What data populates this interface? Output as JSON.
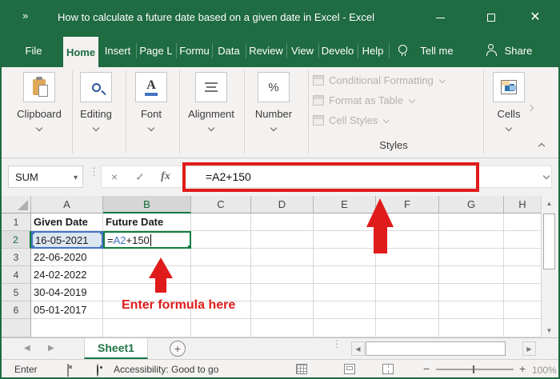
{
  "colors": {
    "title_green": "#1f6b42",
    "accent_green": "#217346",
    "selection_green": "#107c41",
    "reference_blue": "#4472c4",
    "reference_blue_bg": "#dce6f1",
    "annotation_red": "#e01b1b"
  },
  "titlebar": {
    "overflow_icon": "»",
    "title": "How to calculate a future date based on a given date in Excel  -  Excel"
  },
  "tabs": {
    "file": "File",
    "home": "Home",
    "insert": "Insert",
    "page_layout": "Page L",
    "formulas": "Formu",
    "data": "Data",
    "review": "Review",
    "view": "View",
    "developer": "Develo",
    "help": "Help",
    "tell_me": "Tell me",
    "share": "Share"
  },
  "ribbon": {
    "groups": [
      {
        "label": "Clipboard"
      },
      {
        "label": "Editing"
      },
      {
        "label": "Font"
      },
      {
        "label": "Alignment"
      },
      {
        "label": "Number"
      }
    ],
    "styles": {
      "items": [
        {
          "label": "Conditional Formatting"
        },
        {
          "label": "Format as Table"
        },
        {
          "label": "Cell Styles"
        }
      ],
      "caption": "Styles"
    },
    "cells_label": "Cells"
  },
  "formula_bar": {
    "name_box": "SUM",
    "cancel": "×",
    "enter": "✓",
    "insert_function": "fx",
    "formula": "=A2+150"
  },
  "grid": {
    "columns": [
      "A",
      "B",
      "C",
      "D",
      "E",
      "F",
      "G",
      "H"
    ],
    "row_numbers": [
      "1",
      "2",
      "3",
      "4",
      "5",
      "6"
    ],
    "header_a": "Given Date",
    "header_b": "Future Date",
    "dates": [
      "16-05-2021",
      "22-06-2020",
      "24-02-2022",
      "30-04-2019",
      "05-01-2017"
    ],
    "b2_formula": {
      "eq": "=",
      "ref": "A2",
      "rest": "+150"
    }
  },
  "annotations": {
    "enter_formula": "Enter formula here"
  },
  "sheet_bar": {
    "sheet_name": "Sheet1",
    "add_sheet": "+"
  },
  "status_bar": {
    "mode": "Enter",
    "accessibility": "Accessibility: Good to go",
    "zoom_minus": "−",
    "zoom_plus": "+",
    "zoom_level": "100%"
  }
}
